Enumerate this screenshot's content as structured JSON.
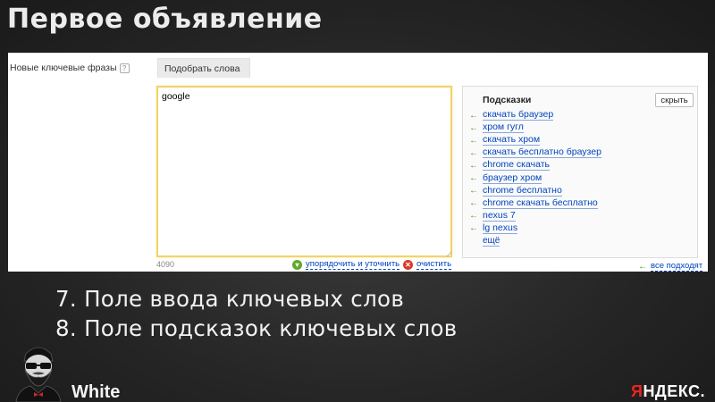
{
  "slide": {
    "title": "Первое объявление"
  },
  "editor": {
    "phrases_label": "Новые ключевые фразы",
    "help_icon": "question-icon",
    "pick_tab_label": "Подобрать слова",
    "textarea_value": "google",
    "char_counter": "4090",
    "sort_label": "упорядочить и уточнить",
    "sort_icon": "chevron-down-icon",
    "clear_label": "очистить",
    "clear_icon": "close-icon",
    "accent_color": "#f1d36a",
    "link_color": "#0044bb"
  },
  "hints": {
    "title": "Подсказки",
    "hide_button_label": "скрыть",
    "items": [
      "скачать браузер",
      "хром гугл",
      "скачать хром",
      "скачать бесплатно браузер",
      "chrome скачать",
      "браузер хром",
      "chrome бесплатно",
      "chrome скачать бесплатно",
      "nexus 7",
      "lg nexus"
    ],
    "more_label": "ещё",
    "all_fit_label": "все подходят",
    "arrow_icon": "arrow-left-icon",
    "arrow_color": "#4e9a23"
  },
  "captions": [
    "7. Поле ввода ключевых слов",
    "8. Поле подсказок ключевых слов"
  ],
  "branding": {
    "brand_word": "White",
    "yandex_red": "Я",
    "yandex_rest": "НДЕКС.",
    "yandex_red_color": "#e8261f"
  }
}
